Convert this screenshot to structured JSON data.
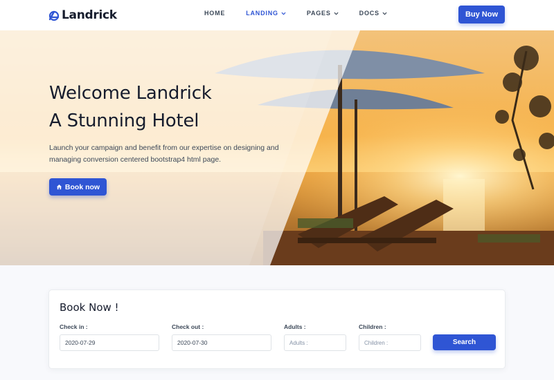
{
  "brand": {
    "name": "Landrick",
    "icon": "landrick-logo-icon",
    "color": "#2f55d4"
  },
  "nav": {
    "items": [
      {
        "label": "HOME",
        "active": false,
        "has_dropdown": false
      },
      {
        "label": "LANDING",
        "active": true,
        "has_dropdown": true
      },
      {
        "label": "PAGES",
        "active": false,
        "has_dropdown": true
      },
      {
        "label": "DOCS",
        "active": false,
        "has_dropdown": true
      }
    ],
    "buy_label": "Buy Now"
  },
  "hero": {
    "title_line1": "Welcome Landrick",
    "title_line2": "A Stunning Hotel",
    "description": "Launch your campaign and benefit from our expertise on designing and managing conversion centered bootstrap4 html page.",
    "book_label": "Book now",
    "book_icon": "home-icon"
  },
  "booking": {
    "title": "Book Now !",
    "checkin": {
      "label": "Check in :",
      "value": "2020-07-29"
    },
    "checkout": {
      "label": "Check out :",
      "value": "2020-07-30"
    },
    "adults": {
      "label": "Adults :",
      "placeholder": "Adults :"
    },
    "children": {
      "label": "Children :",
      "placeholder": "Children :"
    },
    "search_label": "Search"
  },
  "colors": {
    "primary": "#2f55d4",
    "heading": "#161c2d",
    "muted": "#8492a6"
  }
}
